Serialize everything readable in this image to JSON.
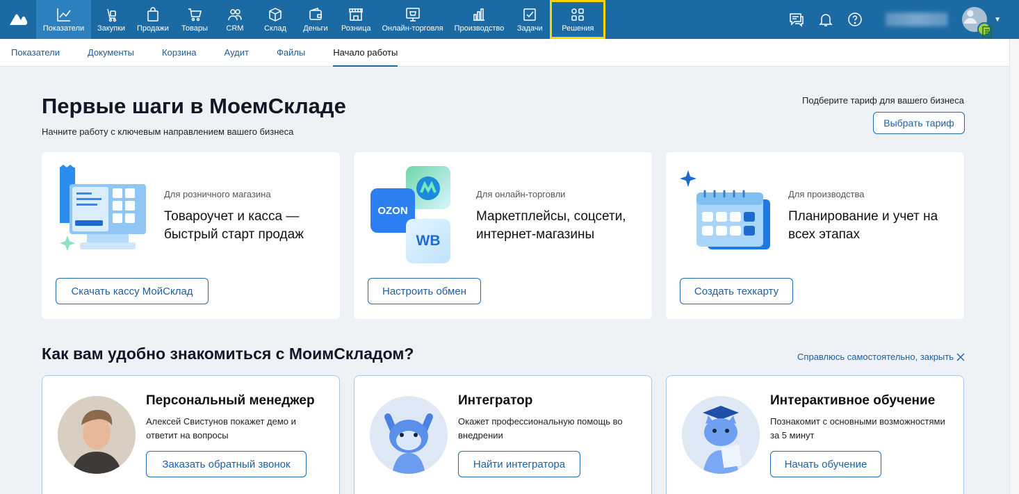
{
  "nav": {
    "items": [
      {
        "label": "Показатели",
        "icon": "chart-icon"
      },
      {
        "label": "Закупки",
        "icon": "purchases-icon"
      },
      {
        "label": "Продажи",
        "icon": "bag-icon"
      },
      {
        "label": "Товары",
        "icon": "cart-icon"
      },
      {
        "label": "CRM",
        "icon": "users-icon"
      },
      {
        "label": "Склад",
        "icon": "box-icon"
      },
      {
        "label": "Деньги",
        "icon": "wallet-icon"
      },
      {
        "label": "Розница",
        "icon": "store-icon"
      },
      {
        "label": "Онлайн-торговля",
        "icon": "online-store-icon"
      },
      {
        "label": "Производство",
        "icon": "bars-icon"
      },
      {
        "label": "Задачи",
        "icon": "checkbox-icon"
      },
      {
        "label": "Решения",
        "icon": "solutions-icon"
      }
    ]
  },
  "subnav": {
    "items": [
      "Показатели",
      "Документы",
      "Корзина",
      "Аудит",
      "Файлы",
      "Начало работы"
    ]
  },
  "main": {
    "title": "Первые шаги в МоемСкладе",
    "subtitle": "Начните работу с ключевым направлением вашего бизнеса",
    "tariff_text": "Подберите тариф для вашего бизнеса",
    "tariff_button": "Выбрать тариф",
    "cards": [
      {
        "label": "Для розничного магазина",
        "title": "Товароучет и касса — быстрый старт продаж",
        "button": "Скачать кассу МойСклад"
      },
      {
        "label": "Для онлайн-торговли",
        "title": "Маркетплейсы, соцсети, интернет-магазины",
        "button": "Настроить обмен",
        "logo_ozon": "OZON",
        "logo_wb": "WB"
      },
      {
        "label": "Для производства",
        "title": "Планирование и учет на всех этапах",
        "button": "Создать техкарту"
      }
    ],
    "section2_title": "Как вам удобно знакомиться с МоимСкладом?",
    "close_link": "Справлюсь самостоятельно, закрыть",
    "options": [
      {
        "title": "Персональный менеджер",
        "desc": "Алексей Свистунов покажет демо и ответит на вопросы",
        "button": "Заказать обратный звонок"
      },
      {
        "title": "Интегратор",
        "desc": "Окажет профессиональную помощь во внедрении",
        "button": "Найти интегратора"
      },
      {
        "title": "Интерактивное обучение",
        "desc": "Познакомит с основными возможностями за 5 минут",
        "button": "Начать обучение"
      }
    ]
  },
  "colors": {
    "topbar": "#1c6aa4",
    "accent": "#1f6ab0",
    "highlight": "#ffd400"
  }
}
